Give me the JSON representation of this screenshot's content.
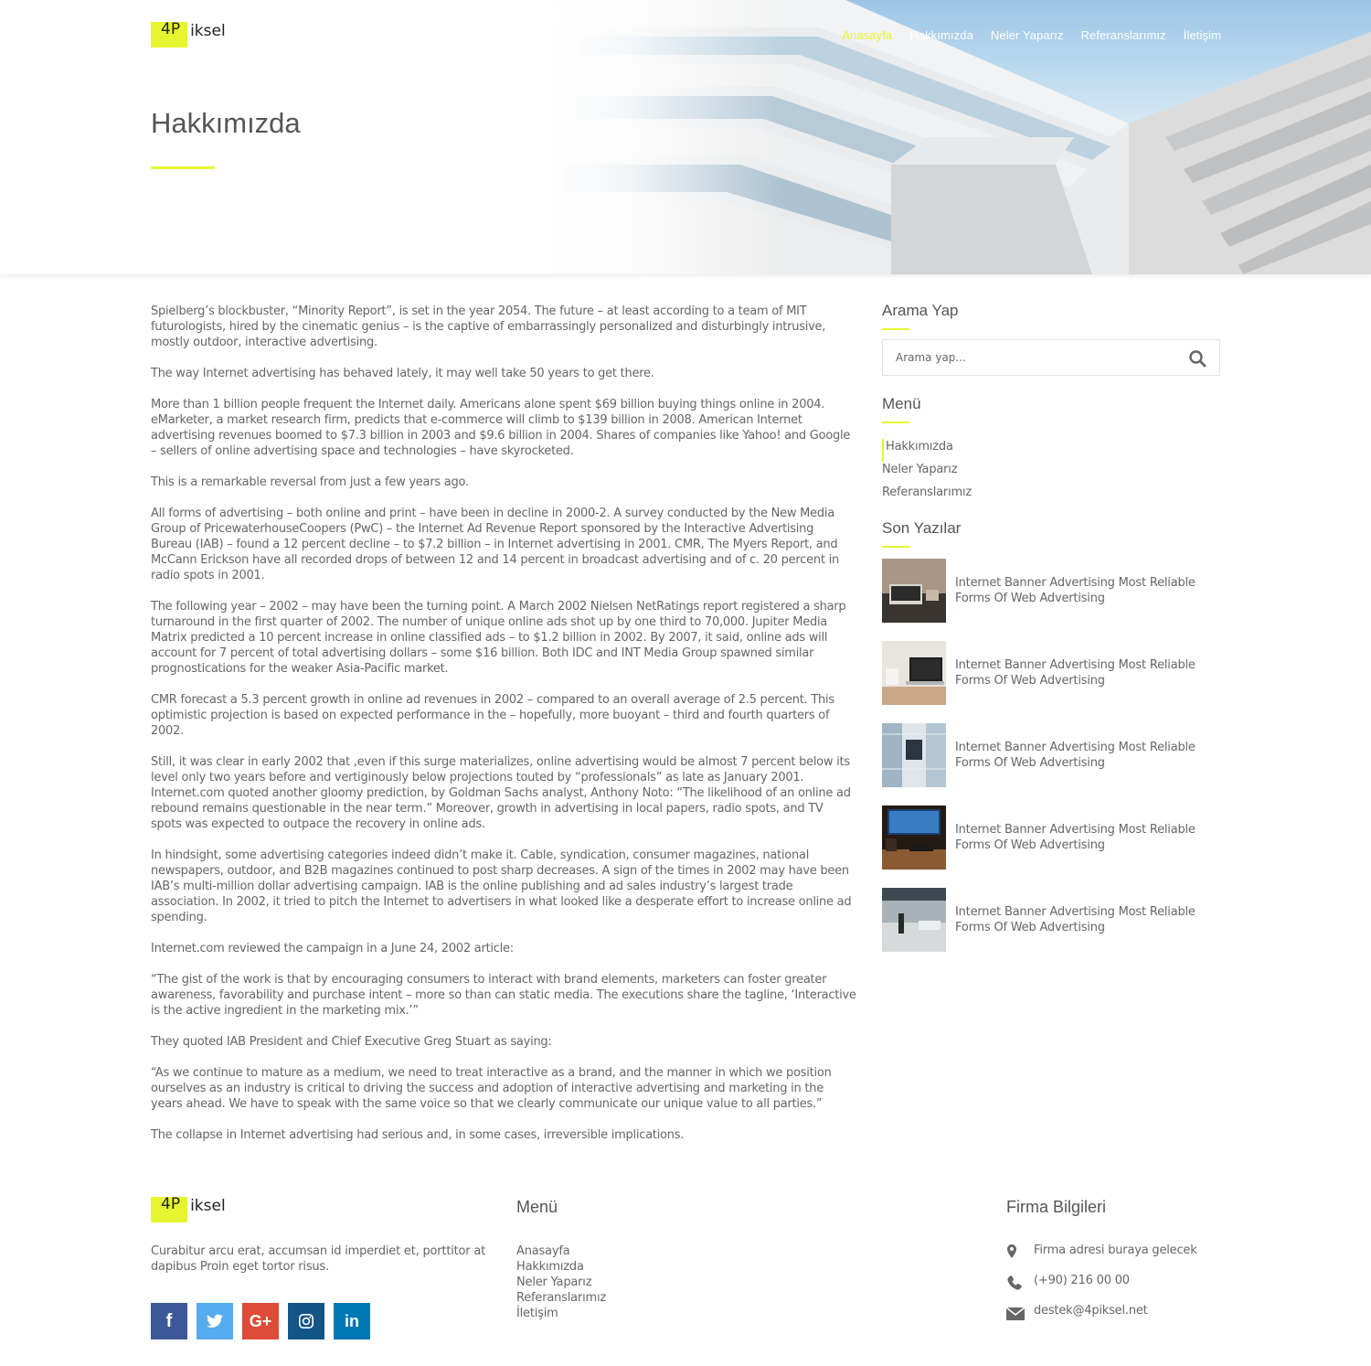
{
  "brand": {
    "mark": "4P",
    "text": "iksel"
  },
  "nav": {
    "items": [
      {
        "label": "Anasayfa",
        "active": true
      },
      {
        "label": "Hakkımızda"
      },
      {
        "label": "Neler Yaparız"
      },
      {
        "label": "Referanslarımız"
      },
      {
        "label": "İletişim"
      }
    ]
  },
  "page": {
    "title": "Hakkımızda"
  },
  "article": {
    "paragraphs": [
      "Spielberg’s blockbuster, “Minority Report”, is set in the year 2054. The future – at least according to a team of MIT futurologists, hired by the cinematic genius – is the captive of embarrassingly personalized and disturbingly intrusive, mostly outdoor, interactive advertising.",
      "The way Internet advertising has behaved lately, it may well take 50 years to get there.",
      "More than 1 billion people frequent the Internet daily. Americans alone spent $69 billion buying things online in 2004. eMarketer, a market research firm, predicts that e-commerce will climb to $139 billion in 2008. American Internet advertising revenues boomed to $7.3 billion in 2003 and $9.6 billion in 2004. Shares of companies like Yahoo! and Google – sellers of online advertising space and technologies – have skyrocketed.",
      "This is a remarkable reversal from just a few years ago.",
      "All forms of advertising – both online and print – have been in decline in 2000-2. A survey conducted by the New Media Group of PricewaterhouseCoopers (PwC) – the Internet Ad Revenue Report sponsored by the Interactive Advertising Bureau (IAB) – found a 12 percent decline – to $7.2 billion – in Internet advertising in 2001. CMR, The Myers Report, and McCann Erickson have all recorded drops of between 12 and 14 percent in broadcast advertising and of c. 20 percent in radio spots in 2001.",
      "The following year – 2002 – may have been the turning point. A March 2002 Nielsen NetRatings report registered a sharp turnaround in the first quarter of 2002. The number of unique online ads shot up by one third to 70,000. Jupiter Media Matrix predicted a 10 percent increase in online classified ads – to $1.2 billion in 2002. By 2007, it said, online ads will account for 7 percent of total advertising dollars – some $16 billion. Both IDC and INT Media Group spawned similar prognostications for the weaker Asia-Pacific market.",
      "CMR forecast a 5.3 percent growth in online ad revenues in 2002 – compared to an overall average of 2.5 percent. This optimistic projection is based on expected performance in the – hopefully, more buoyant – third and fourth quarters of 2002.",
      "Still, it was clear in early 2002 that ,even if this surge materializes, online advertising would be almost 7 percent below its level only two years before and vertiginously below projections touted by “professionals” as late as January 2001. Internet.com quoted another gloomy prediction, by Goldman Sachs analyst, Anthony Noto: “The likelihood of an online ad rebound remains questionable in the near term.” Moreover, growth in advertising in local papers, radio spots, and TV spots was expected to outpace the recovery in online ads.",
      "In hindsight, some advertising categories indeed didn’t make it. Cable, syndication, consumer magazines, national newspapers, outdoor, and B2B magazines continued to post sharp decreases. A sign of the times in 2002 may have been IAB’s multi-million dollar advertising campaign. IAB is the online publishing and ad sales industry’s largest trade association. In 2002, it tried to pitch the Internet to advertisers in what looked like a desperate effort to increase online ad spending.",
      "Internet.com reviewed the campaign in a June 24, 2002 article:",
      "“The gist of the work is that by encouraging consumers to interact with brand elements, marketers can foster greater awareness, favorability and purchase intent – more so than can static media. The executions share the tagline, ‘Interactive is the active ingredient in the marketing mix.’”",
      "They quoted IAB President and Chief Executive Greg Stuart as saying:",
      "“As we continue to mature as a medium, we need to treat interactive as a brand, and the manner in which we position ourselves as an industry is critical to driving the success and adoption of interactive advertising and marketing in the years ahead. We have to speak with the same voice so that we clearly communicate our unique value to all parties.”",
      "The collapse in Internet advertising had serious and, in some cases, irreversible implications."
    ]
  },
  "sidebar": {
    "search": {
      "title": "Arama Yap",
      "placeholder": "Arama yap..."
    },
    "menu": {
      "title": "Menü",
      "items": [
        "Hakkımızda",
        "Neler Yaparız",
        "Referanslarımız"
      ]
    },
    "recent": {
      "title": "Son Yazılar",
      "posts": [
        {
          "title": "Internet Banner Advertising Most Reliable Forms Of Web Advertising",
          "thumb": "desk-laptop"
        },
        {
          "title": "Internet Banner Advertising Most Reliable Forms Of Web Advertising",
          "thumb": "laptop-table"
        },
        {
          "title": "Internet Banner Advertising Most Reliable Forms Of Web Advertising",
          "thumb": "building"
        },
        {
          "title": "Internet Banner Advertising Most Reliable Forms Of Web Advertising",
          "thumb": "monitor-desk"
        },
        {
          "title": "Internet Banner Advertising Most Reliable Forms Of Web Advertising",
          "thumb": "street"
        }
      ]
    }
  },
  "footer": {
    "about": "Curabitur arcu erat, accumsan id imperdiet et, porttitor at dapibus Proin eget tortor risus.",
    "social": [
      "f",
      "t",
      "G+",
      "instagram-icon",
      "in"
    ],
    "menu": {
      "title": "Menü",
      "items": [
        "Anasayfa",
        "Hakkımızda",
        "Neler Yaparız",
        "Referanslarımız",
        "İletişim"
      ]
    },
    "company": {
      "title": "Firma Bilgileri",
      "address": "Firma adresi buraya gelecek",
      "phone": "(+90) 216 00 00",
      "email": "destek@4piksel.net"
    }
  },
  "colors": {
    "accent": "#e6f530",
    "text": "#666666",
    "heading": "#555555"
  }
}
